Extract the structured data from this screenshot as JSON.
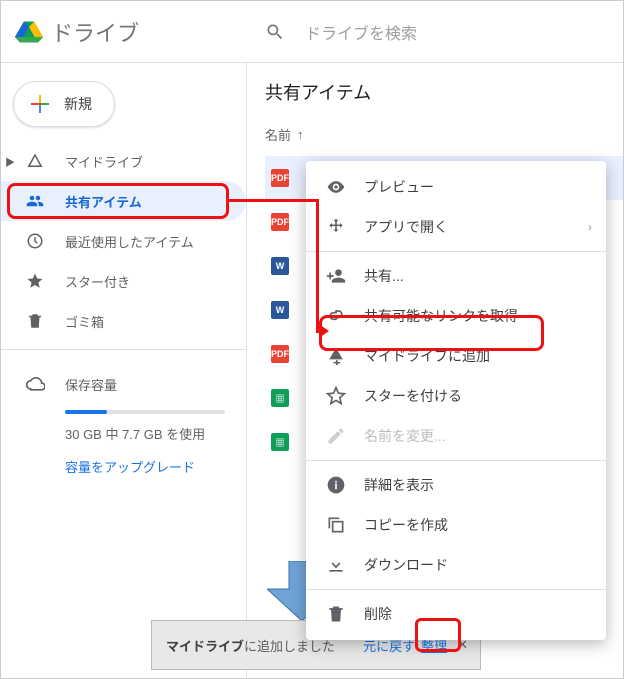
{
  "brand": {
    "name": "ドライブ"
  },
  "search": {
    "placeholder": "ドライブを検索"
  },
  "new_button": {
    "label": "新規"
  },
  "sidebar": {
    "items": [
      {
        "label": "マイドライブ",
        "icon": "drive-triangle-icon"
      },
      {
        "label": "共有アイテム",
        "icon": "people-icon",
        "active": true
      },
      {
        "label": "最近使用したアイテム",
        "icon": "clock-icon"
      },
      {
        "label": "スター付き",
        "icon": "star-icon"
      },
      {
        "label": "ゴミ箱",
        "icon": "trash-icon"
      }
    ]
  },
  "storage": {
    "heading": "保存容量",
    "text": "30 GB 中 7.7 GB を使用",
    "fill_percent": 26,
    "upgrade_link": "容量をアップグレード"
  },
  "main": {
    "title": "共有アイテム",
    "column_header": "名前",
    "sort_dir_glyph": "↑"
  },
  "files": [
    {
      "type": "pdf"
    },
    {
      "type": "pdf"
    },
    {
      "type": "word"
    },
    {
      "type": "word"
    },
    {
      "type": "pdf"
    },
    {
      "type": "sheet"
    },
    {
      "type": "sheet"
    }
  ],
  "context_menu": {
    "preview": "プレビュー",
    "open_with": "アプリで開く",
    "share": "共有...",
    "get_link": "共有可能なリンクを取得",
    "add_to_drive": "マイドライブに追加",
    "star": "スターを付ける",
    "rename": "名前を変更...",
    "details": "詳細を表示",
    "make_copy": "コピーを作成",
    "download": "ダウンロード",
    "remove": "削除"
  },
  "toast": {
    "bold_part": "マイドライブ",
    "rest": "に追加しました",
    "undo": "元に戻す",
    "organize": "整理",
    "close_glyph": "✕"
  }
}
